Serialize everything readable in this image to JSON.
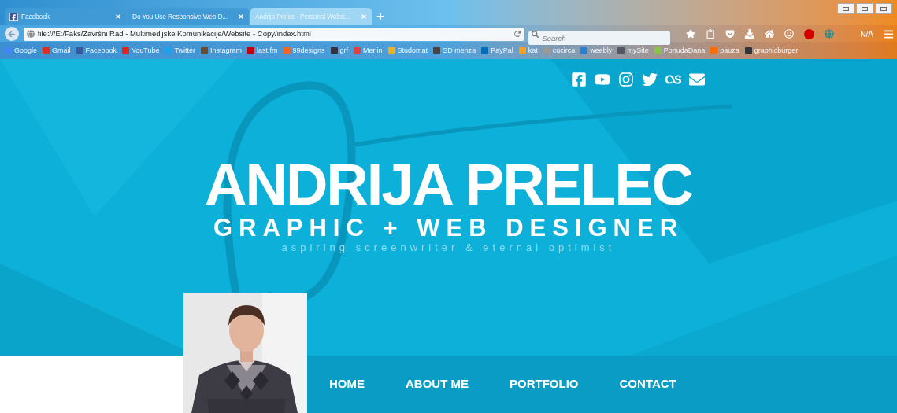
{
  "browser": {
    "tabs": [
      {
        "title": "Facebook",
        "selected": false
      },
      {
        "title": "Do You Use Responsive Web D...",
        "selected": false
      },
      {
        "title": "Andrija Prelec - Personal Websi...",
        "selected": true
      }
    ],
    "address": "file:///E:/Faks/Završni Rad - Multimedijske Komunikacije/Website - Copy/index.html",
    "search": {
      "placeholder": "Search"
    },
    "addon_label": "N/A",
    "bookmarks": [
      "Google",
      "Gmail",
      "Facebook",
      "YouTube",
      "Twitter",
      "Instagram",
      "last.fm",
      "99designs",
      "grf",
      "Merlin",
      "Studomat",
      "SD menza",
      "PayPal",
      "kat",
      "cucirca",
      "weebly",
      "mySite",
      "PonudaDana",
      "pauza",
      "graphicburger"
    ]
  },
  "hero": {
    "title": "ANDRIJA PRELEC",
    "subtitle": "GRAPHIC + WEB DESIGNER",
    "tagline": "aspiring screenwriter & eternal optimist"
  },
  "nav": [
    {
      "label": "HOME"
    },
    {
      "label": "ABOUT ME"
    },
    {
      "label": "PORTFOLIO"
    },
    {
      "label": "CONTACT"
    }
  ]
}
